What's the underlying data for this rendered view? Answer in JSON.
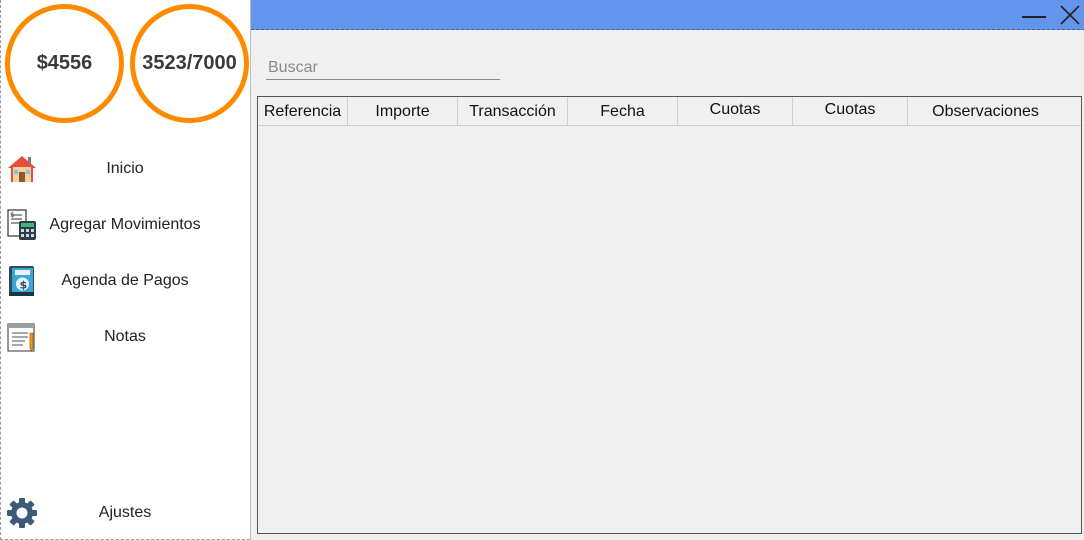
{
  "sidebar": {
    "balance": "$4556",
    "limit": "3523/7000",
    "items": [
      {
        "label": "Inicio",
        "icon": "home-icon"
      },
      {
        "label": "Agregar Movimientos",
        "icon": "calculator-document-icon"
      },
      {
        "label": "Agenda de Pagos",
        "icon": "payment-book-icon"
      },
      {
        "label": "Notas",
        "icon": "notepad-icon"
      }
    ],
    "settings": {
      "label": "Ajustes",
      "icon": "gear-icon"
    }
  },
  "colors": {
    "titlebar": "#6495ed",
    "circle_border": "#ff8a00",
    "main_background": "#f0f0f0"
  },
  "search": {
    "placeholder": "Buscar",
    "value": ""
  },
  "table": {
    "columns": [
      "Referencia",
      "Importe",
      "Transacción",
      "Fecha",
      "Cuotas",
      "Cuotas",
      "Observaciones"
    ],
    "rows": []
  }
}
